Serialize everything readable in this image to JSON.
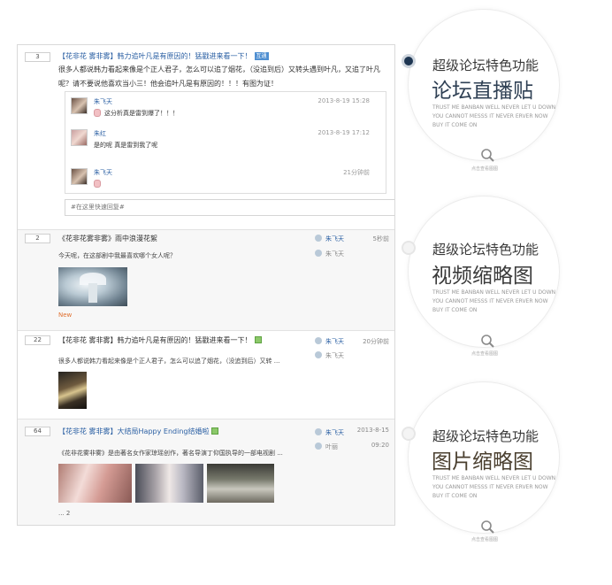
{
  "posts": [
    {
      "count": "3",
      "title_prefix": "【花非花 雾非雾】",
      "title_main": "韩力追叶凡是有原因的！猛戳进来看一下！",
      "tag": "互通",
      "body": "很多人都说韩力看起来像是个正人君子，怎么可以追了烟花，（没追到后）又转头遇到叶凡，又追了叶凡呢？请不要说他喜欢当小三！他会追叶凡是有原因的！！！有图为证！",
      "replies": [
        {
          "name": "朱飞天",
          "time": "2013-8-19 15:28",
          "text": "这分析真是雷到爆了！！！"
        },
        {
          "name": "朱红",
          "time": "2013-8-19 17:12",
          "text": "是的呢 真是雷到我了呢"
        },
        {
          "name": "朱飞天",
          "time": "21分钟前",
          "text": ""
        }
      ],
      "reply_placeholder": "#在这里快速回复#"
    },
    {
      "count": "2",
      "title": "《花非花雾非雾》雨中浪漫花絮",
      "author": "朱飞天",
      "last_reply": "朱飞天",
      "time": "5秒前",
      "subtitle": "今天呢，在这部剧中我最喜欢哪个女人呢？",
      "new_label": "New"
    },
    {
      "count": "22",
      "title": "【花非花 雾非雾】韩力追叶凡是有原因的！猛戳进来看一下！",
      "author": "朱飞天",
      "last_reply": "朱飞天",
      "time": "20分钟前",
      "subtitle": "很多人都说韩力看起来像是个正人君子，怎么可以追了烟花，（没追到后）又转 ..."
    },
    {
      "count": "64",
      "title_prefix": "【花非花 雾非雾】",
      "title_main": "大结局Happy Ending结婚啦",
      "author": "朱飞天",
      "last_reply": "叶丽",
      "time": "2013-8-15",
      "time2": "09:20",
      "subtitle": "《花非花雾非雾》是由著名女作家琼瑶创作，著名导演丁仰国执导的一部电视剧 ...",
      "ellipsis": "... 2"
    }
  ],
  "features": [
    {
      "title": "超级论坛特色功能",
      "heading": "论坛直播贴",
      "desc": "TRUST ME BANBAN WELL NEVER LET U DOWN YOU CANNOT MESSS IT NEVER ERVER NOW BUY IT COME ON",
      "hint": "点击查看图图",
      "active": true
    },
    {
      "title": "超级论坛特色功能",
      "heading": "视频缩略图",
      "desc": "TRUST ME BANBAN WELL NEVER LET U DOWN YOU CANNOT MESSS IT NEVER ERVER NOW BUY IT COME ON",
      "hint": "点击查看图图",
      "active": false
    },
    {
      "title": "超级论坛特色功能",
      "heading": "图片缩略图",
      "desc": "TRUST ME BANBAN WELL NEVER LET U DOWN YOU CANNOT MESSS IT NEVER ERVER NOW BUY IT COME ON",
      "hint": "点击查看图图",
      "active": false
    }
  ],
  "colors": {
    "accent_blue": "#2a5fa3",
    "active_dot": "#1e3652",
    "heading_1": "#2f4054",
    "heading_2": "#3a3a3a",
    "heading_3": "#4a3f2f",
    "new_orange": "#e07030"
  },
  "icons": [
    "search-icon",
    "emoji-icon",
    "picture-icon",
    "user-icon"
  ]
}
